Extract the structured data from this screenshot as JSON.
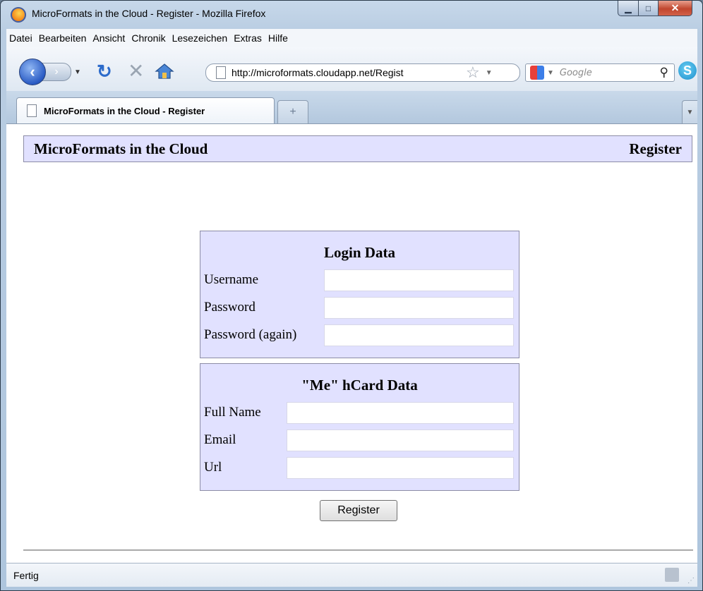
{
  "window": {
    "title": "MicroFormats in the Cloud - Register - Mozilla Firefox"
  },
  "menu": {
    "items": [
      "Datei",
      "Bearbeiten",
      "Ansicht",
      "Chronik",
      "Lesezeichen",
      "Extras",
      "Hilfe"
    ]
  },
  "navbar": {
    "url": "http://microformats.cloudapp.net/Regist",
    "search_placeholder": "Google"
  },
  "tab": {
    "title": "MicroFormats in the Cloud - Register",
    "new_tab": "+"
  },
  "page": {
    "site_title": "MicroFormats in the Cloud",
    "page_title": "Register",
    "login": {
      "heading": "Login Data",
      "fields": [
        {
          "label": "Username",
          "value": ""
        },
        {
          "label": "Password",
          "value": ""
        },
        {
          "label": "Password (again)",
          "value": ""
        }
      ]
    },
    "hcard": {
      "heading": "\"Me\" hCard Data",
      "fields": [
        {
          "label": "Full Name",
          "value": ""
        },
        {
          "label": "Email",
          "value": ""
        },
        {
          "label": "Url",
          "value": ""
        }
      ]
    },
    "register_button": "Register"
  },
  "status": {
    "text": "Fertig"
  },
  "colors": {
    "panel_bg": "#e1e1ff",
    "panel_border": "#8c8ca6"
  }
}
